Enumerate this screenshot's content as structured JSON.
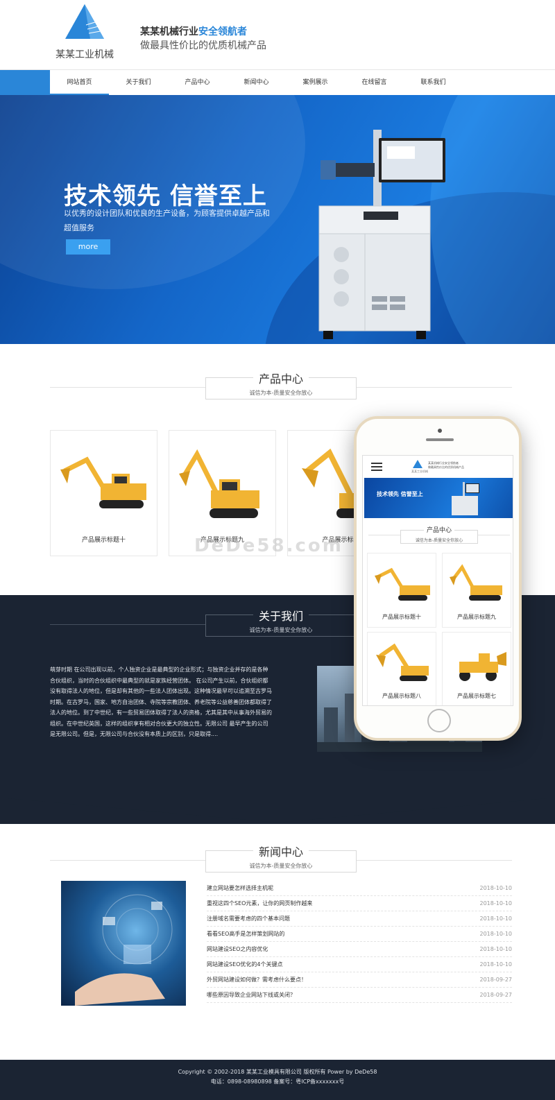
{
  "header": {
    "logo_text": "某某工业机械",
    "slogan_line1_prefix": "某某机械行业",
    "slogan_line1_accent": "安全领航者",
    "slogan_line2": "做最具性价比的优质机械产品"
  },
  "nav": {
    "items": [
      "网站首页",
      "关于我们",
      "产品中心",
      "新闻中心",
      "案例展示",
      "在线留言",
      "联系我们"
    ],
    "active_index": 0
  },
  "banner": {
    "title": "技术领先 信誉至上",
    "desc": "以优秀的设计团队和优良的生产设备，为顾客提供卓越产品和超值服务",
    "more_label": "more"
  },
  "products": {
    "title": "产品中心",
    "subtitle": "诚信为本-质量安全你放心",
    "items": [
      "产品展示标题十",
      "产品展示标题九",
      "产品展示标题"
    ]
  },
  "watermark": "DeDe58.com",
  "about": {
    "title": "关于我们",
    "subtitle": "诚信为本-质量安全你放心",
    "text": "萌芽时期 在公司出现以前，个人独资企业是最典型的企业形式；与独资企业并存的是各种合伙组织，当时的合伙组织中最典型的就是家族经营团体。 在公司产生以前，合伙组织都没有取得法人的地位，但是却有其他的一些法人团体出现。这种情况最早可以追溯至古罗马时期。在古罗马，国家、地方自治团体、寺院等宗教团体、养老院等公益慈善团体都取得了法人的地位。到了中世纪，有一些贸易团体取得了法人的资格，尤其是其中从事海外贸易的组织。在中世纪英国，这样的组织享有相对合伙更大的独立性。无限公司 最早产生的公司是无限公司。但是，无限公司与合伙没有本质上的区别，只是取得...."
  },
  "news": {
    "title": "新闻中心",
    "subtitle": "诚信为本-质量安全你放心",
    "items": [
      {
        "title": "建立网站要怎样选择主机呢",
        "date": "2018-10-10"
      },
      {
        "title": "重视这四个SEO元素，让你的网页制作越来",
        "date": "2018-10-10"
      },
      {
        "title": "注册域名需要考虑的四个基本问题",
        "date": "2018-10-10"
      },
      {
        "title": "看看SEO高手是怎样策划网站的",
        "date": "2018-10-10"
      },
      {
        "title": "网站建设SEO之内容优化",
        "date": "2018-10-10"
      },
      {
        "title": "网站建设SEO优化的4个关键点",
        "date": "2018-10-10"
      },
      {
        "title": "外贸网站建设如何做？需考虑什么要点！",
        "date": "2018-09-27"
      },
      {
        "title": "哪些原因导致企业网站下线或关闭？",
        "date": "2018-09-27"
      }
    ]
  },
  "footer": {
    "line1": "Copyright © 2002-2018 某某工业模具有限公司 版权所有 Power by DeDe58",
    "line2": "电话：0898-08980898 备案号：粤ICP备xxxxxxx号"
  },
  "phone": {
    "logo_text": "某某工业机械",
    "slogan1": "某某机械行业安全领航者",
    "slogan2": "做最具性价比的优质机械产品",
    "banner_title": "技术领先 信誉至上",
    "head_title": "产品中心",
    "head_sub": "诚信为本-质量安全你放心",
    "items": [
      "产品展示标题十",
      "产品展示标题九",
      "产品展示标题八",
      "产品展示标题七"
    ]
  },
  "colors": {
    "accent": "#2a86d8",
    "dark": "#1b2433",
    "excavator": "#f1b433"
  }
}
